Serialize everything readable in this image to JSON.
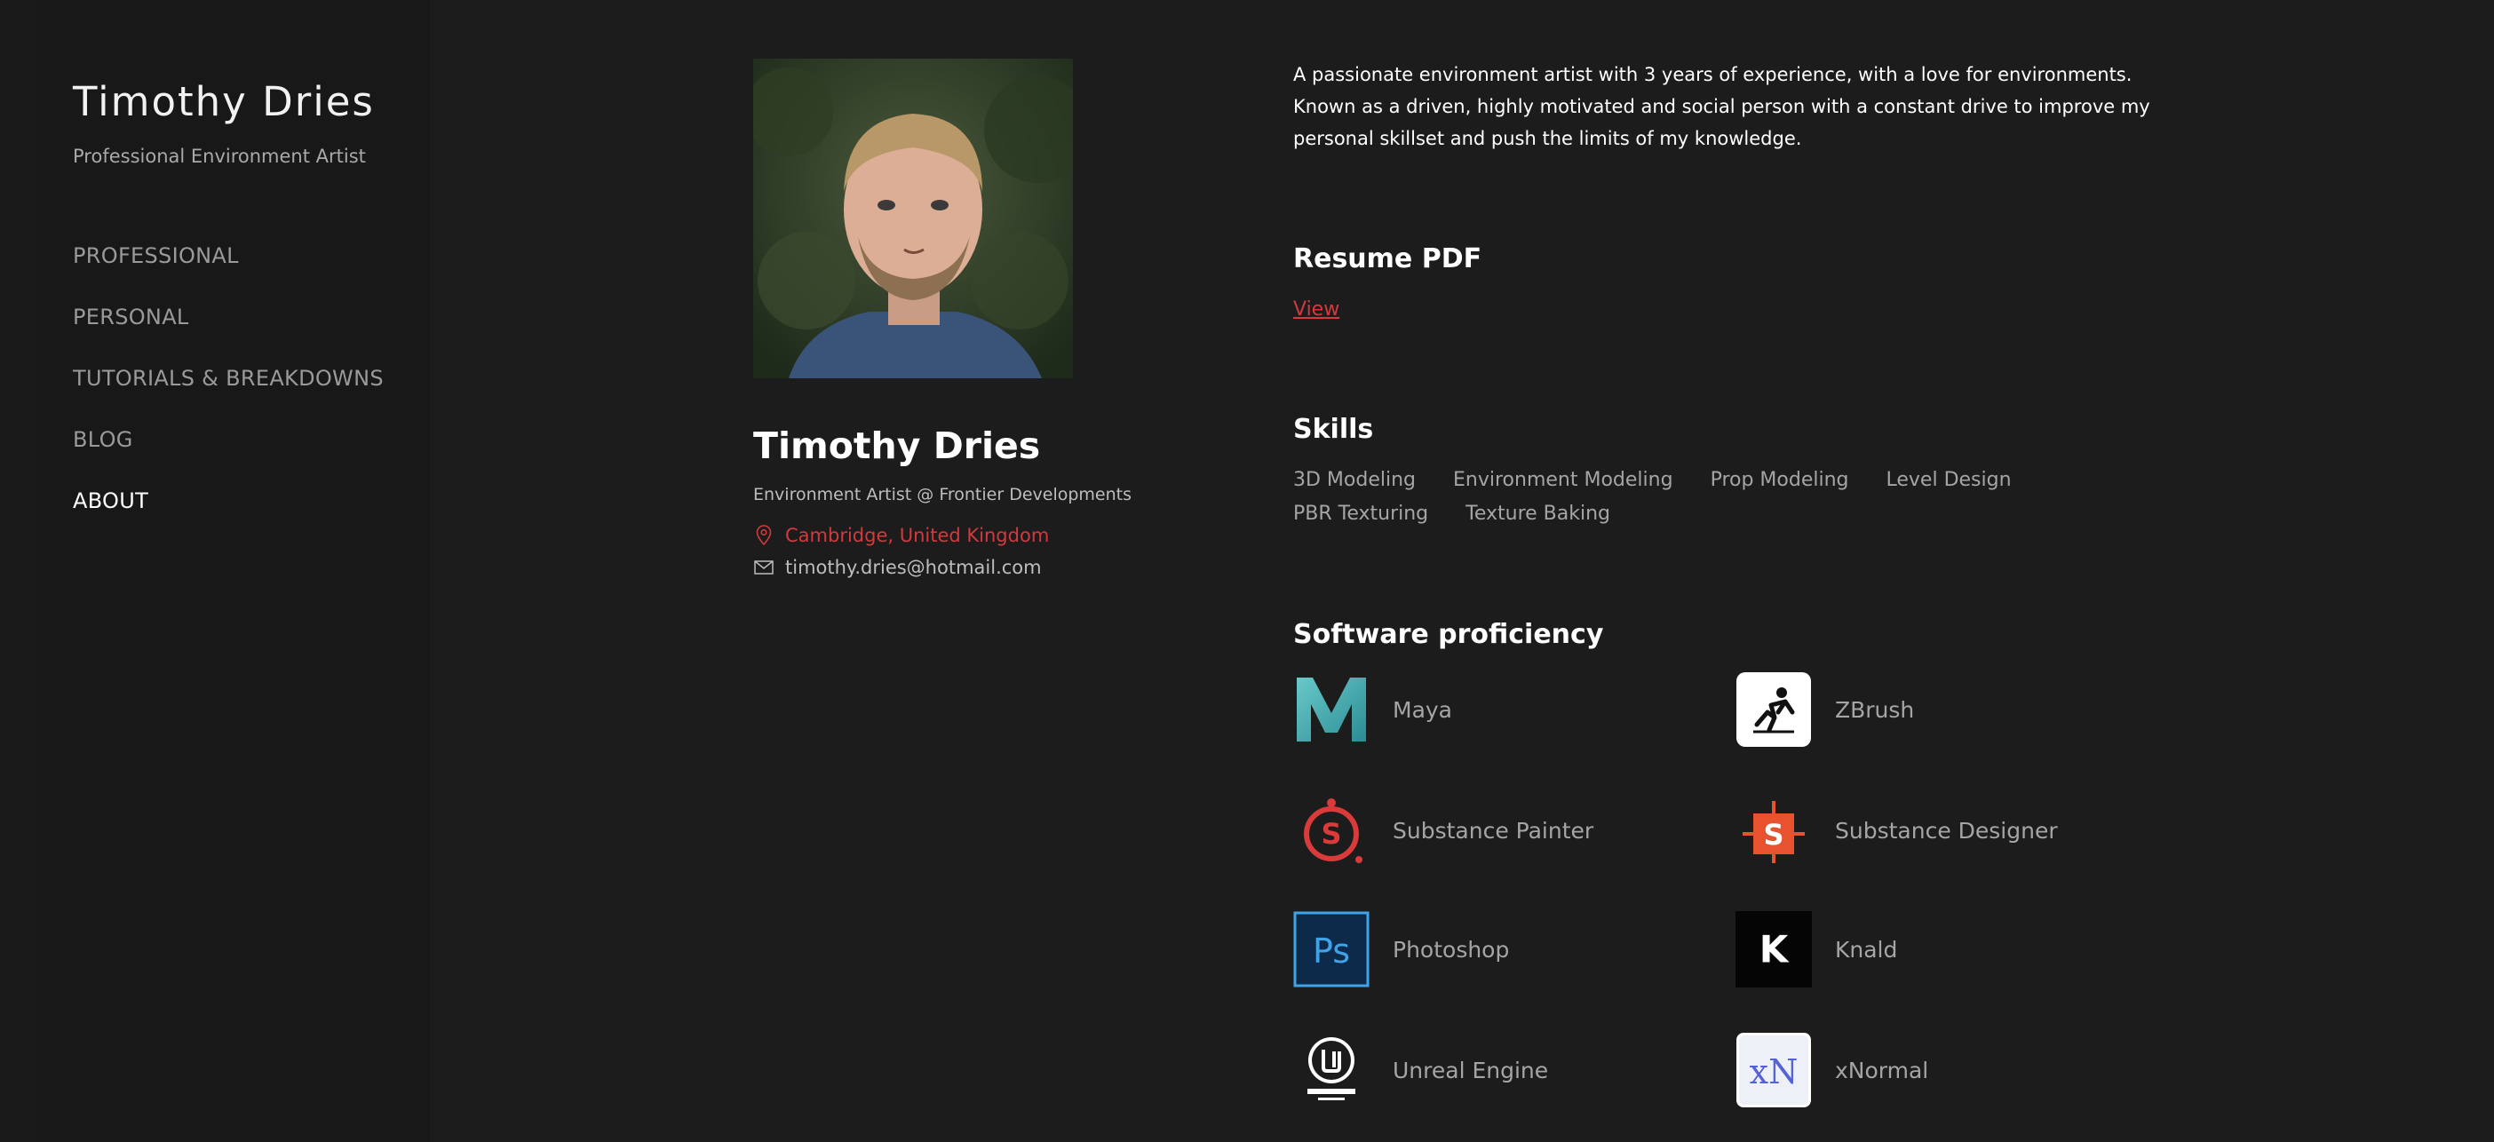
{
  "sidebar": {
    "title": "Timothy Dries",
    "subtitle": "Professional Environment Artist",
    "nav": [
      {
        "label": "PROFESSIONAL"
      },
      {
        "label": "PERSONAL"
      },
      {
        "label": "TUTORIALS & BREAKDOWNS"
      },
      {
        "label": "BLOG"
      },
      {
        "label": "ABOUT",
        "active": true
      }
    ]
  },
  "profile": {
    "photo_alt": "Portrait photo",
    "name": "Timothy Dries",
    "title": "Environment Artist @ Frontier Developments",
    "location": "Cambridge, United Kingdom",
    "email": "timothy.dries@hotmail.com",
    "location_icon": "map-pin-icon",
    "email_icon": "envelope-icon"
  },
  "bio": {
    "line1": "A passionate environment artist with 3 years of experience, with a love for environments.",
    "line2": "Known as a driven, highly motivated and social person with a constant drive to improve my personal skillset and push the limits of my knowledge."
  },
  "resume": {
    "heading": "Resume PDF",
    "link_label": "View"
  },
  "skills": {
    "heading": "Skills",
    "items": [
      "3D Modeling",
      "Environment Modeling",
      "Prop Modeling",
      "Level Design",
      "PBR Texturing",
      "Texture Baking"
    ]
  },
  "software": {
    "heading": "Software proficiency",
    "items": [
      {
        "label": "Maya",
        "icon": "maya-logo-icon"
      },
      {
        "label": "ZBrush",
        "icon": "zbrush-logo-icon"
      },
      {
        "label": "Substance Painter",
        "icon": "substance-painter-logo-icon"
      },
      {
        "label": "Substance Designer",
        "icon": "substance-designer-logo-icon"
      },
      {
        "label": "Photoshop",
        "icon": "photoshop-logo-icon",
        "logo_text": "Ps"
      },
      {
        "label": "Knald",
        "icon": "knald-logo-icon",
        "logo_text": "K"
      },
      {
        "label": "Unreal Engine",
        "icon": "unreal-engine-logo-icon"
      },
      {
        "label": "xNormal",
        "icon": "xnormal-logo-icon",
        "logo_text": "xN"
      }
    ]
  },
  "colors": {
    "background": "#1c1c1c",
    "sidebar": "#181818",
    "accent": "#d23a3e",
    "text_muted": "#a5a5a5"
  }
}
